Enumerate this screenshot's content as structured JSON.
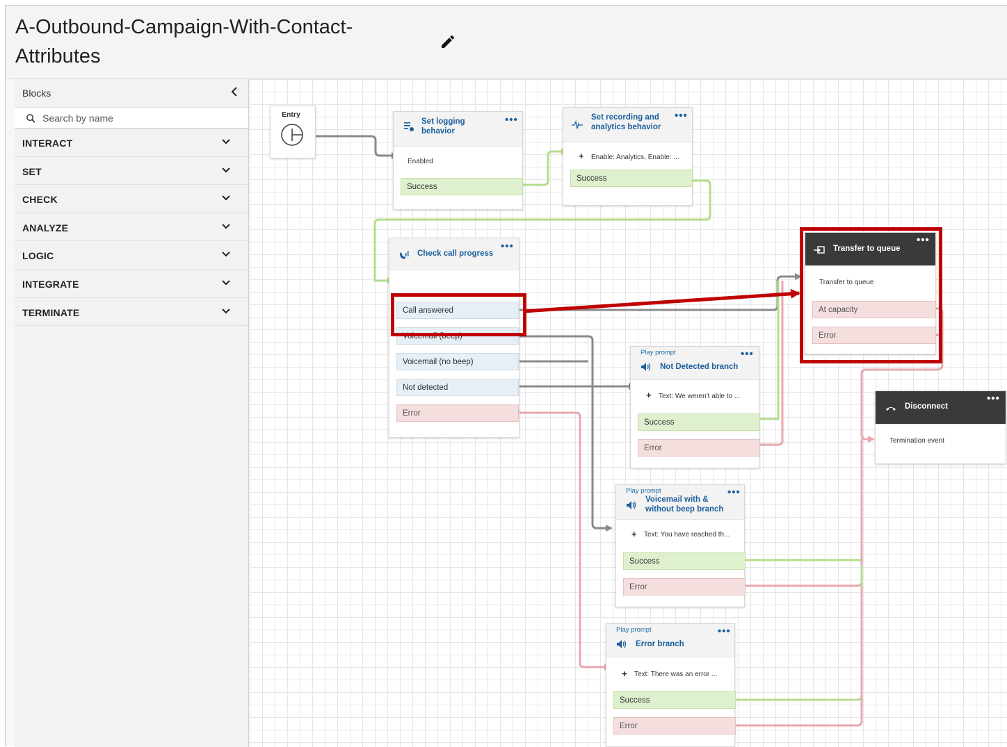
{
  "flow": {
    "title": "A-Outbound-Campaign-With-Contact-Attributes"
  },
  "sidebar": {
    "heading": "Blocks",
    "search_placeholder": "Search by name",
    "categories": [
      {
        "label": "INTERACT"
      },
      {
        "label": "SET"
      },
      {
        "label": "CHECK"
      },
      {
        "label": "ANALYZE"
      },
      {
        "label": "LOGIC"
      },
      {
        "label": "INTEGRATE"
      },
      {
        "label": "TERMINATE"
      }
    ]
  },
  "colors": {
    "success": "#b5dc8c",
    "error": "#e7a7ad",
    "default": "#8a8a8a",
    "highlight": "#c00000"
  },
  "nodes": {
    "entry": {
      "label": "Entry"
    },
    "set_logging": {
      "title": "Set logging behavior",
      "icon": "logging-icon",
      "param": "Enabled",
      "success": "Success",
      "menu": "•••"
    },
    "set_recording": {
      "title": "Set recording and analytics behavior",
      "icon": "waveform-icon",
      "param": "Enable: Analytics, Enable: ...",
      "success": "Success",
      "menu": "•••"
    },
    "check_call": {
      "title": "Check call progress",
      "icon": "phone-signal-icon",
      "menu": "•••",
      "branches": [
        "Call answered",
        "Voicemail (beep)",
        "Voicemail (no beep)",
        "Not detected"
      ],
      "error": "Error"
    },
    "transfer": {
      "title": "Transfer to queue",
      "icon": "transfer-icon",
      "menu": "•••",
      "param": "Transfer to queue",
      "at_capacity": "At capacity",
      "error": "Error"
    },
    "not_detected": {
      "kind": "Play prompt",
      "title": "Not Detected branch",
      "icon": "speaker-icon",
      "menu": "•••",
      "param": "Text: We weren't able to ...",
      "success": "Success",
      "error": "Error"
    },
    "disconnect": {
      "title": "Disconnect",
      "icon": "hangup-icon",
      "menu": "•••",
      "param": "Termination event"
    },
    "voicemail": {
      "kind": "Play prompt",
      "title": "Voicemail with & without beep branch",
      "icon": "speaker-icon",
      "menu": "•••",
      "param": "Text: You have reached th...",
      "success": "Success",
      "error": "Error"
    },
    "error_branch": {
      "kind": "Play prompt",
      "title": "Error branch",
      "icon": "speaker-icon",
      "menu": "•••",
      "param": "Text: There was an error ...",
      "success": "Success",
      "error": "Error"
    }
  }
}
